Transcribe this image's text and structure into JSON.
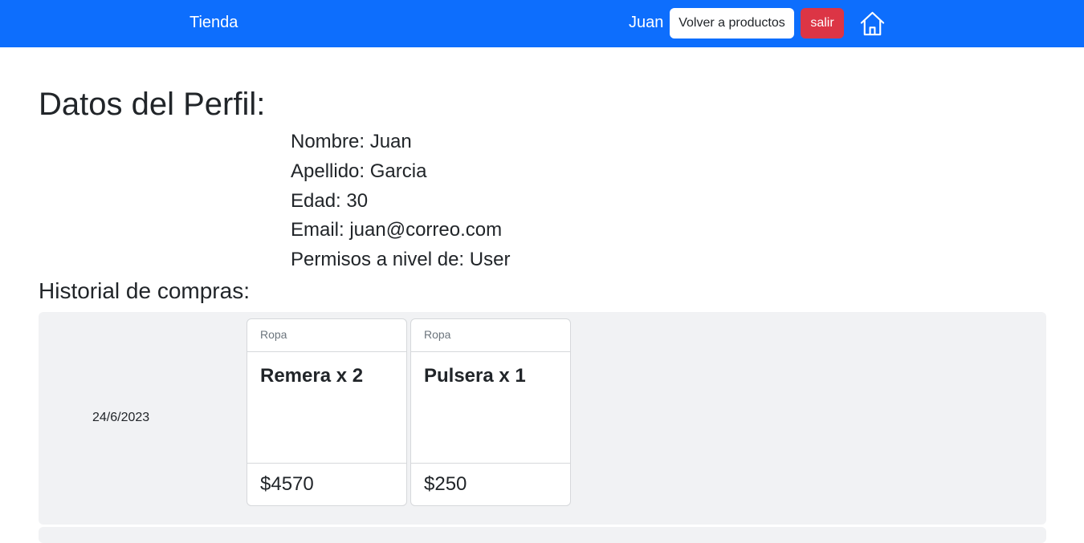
{
  "navbar": {
    "brand": "Tienda",
    "user_name": "Juan",
    "back_button_label": "Volver a productos",
    "exit_button_label": "salir",
    "home_icon": "home-icon",
    "background_color": "#0d6efd"
  },
  "profile": {
    "title": "Datos del Perfil:",
    "fields": [
      "Nombre: Juan",
      "Apellido: Garcia",
      "Edad: 30",
      "Email: juan@correo.com",
      "Permisos a nivel de: User"
    ]
  },
  "history": {
    "title": "Historial de compras:",
    "orders": [
      {
        "date": "24/6/2023",
        "items": [
          {
            "category": "Ropa",
            "name": "Remera x 2",
            "price": "$4570"
          },
          {
            "category": "Ropa",
            "name": "Pulsera x 1",
            "price": "$250"
          }
        ]
      }
    ]
  },
  "colors": {
    "primary": "#0d6efd",
    "danger": "#dc3545",
    "row_background": "#f1f2f4"
  }
}
